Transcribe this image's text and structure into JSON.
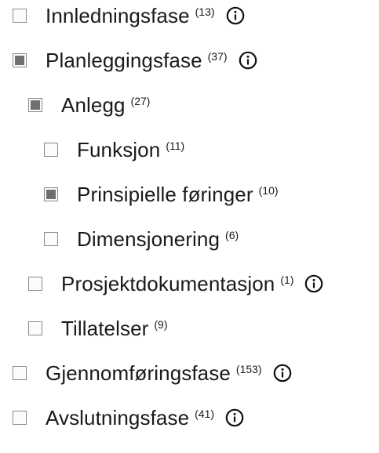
{
  "items": [
    {
      "label": "Innledningsfase",
      "count": "(13)",
      "state": "unchecked",
      "level": 0,
      "info": true,
      "info_icon": "info-circle-icon"
    },
    {
      "label": "Planleggingsfase",
      "count": "(37)",
      "state": "partial",
      "level": 0,
      "info": true,
      "info_icon": "info-circle-icon"
    },
    {
      "label": "Anlegg",
      "count": "(27)",
      "state": "partial",
      "level": 1,
      "info": false
    },
    {
      "label": "Funksjon",
      "count": "(11)",
      "state": "unchecked",
      "level": 2,
      "info": false
    },
    {
      "label": "Prinsipielle føringer",
      "count": "(10)",
      "state": "partial",
      "level": 2,
      "info": false
    },
    {
      "label": "Dimensjonering",
      "count": "(6)",
      "state": "unchecked",
      "level": 2,
      "info": false
    },
    {
      "label": "Prosjektdokumentasjon",
      "count": "(1)",
      "state": "unchecked",
      "level": 1,
      "info": true,
      "info_icon": "info-circle-icon"
    },
    {
      "label": "Tillatelser",
      "count": "(9)",
      "state": "unchecked",
      "level": 1,
      "info": false
    },
    {
      "label": "Gjennomføringsfase",
      "count": "(153)",
      "state": "unchecked",
      "level": 0,
      "info": true,
      "info_icon": "info-circle-icon"
    },
    {
      "label": "Avslutningsfase",
      "count": "(41)",
      "state": "unchecked",
      "level": 0,
      "info": true,
      "info_icon": "info-circle-icon"
    }
  ],
  "colors": {
    "text": "#1a1a1a",
    "checkbox_border": "#8a8a8a",
    "checkbox_fill": "#707070"
  }
}
